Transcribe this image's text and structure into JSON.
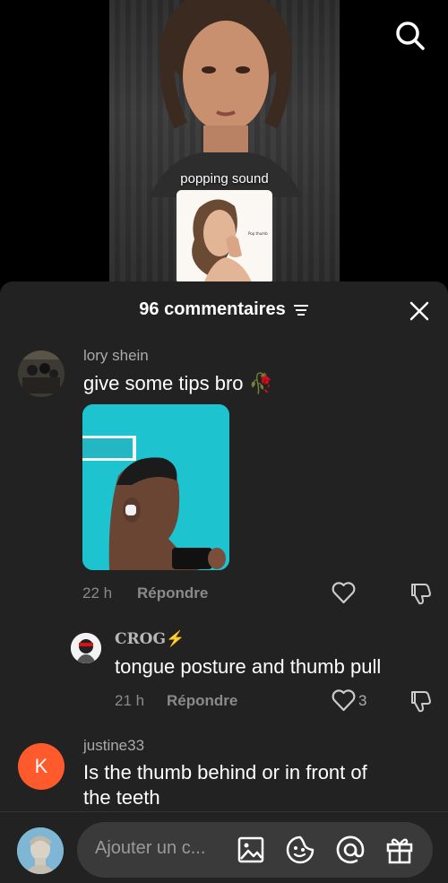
{
  "video": {
    "caption": "popping sound",
    "search_icon": "search-icon"
  },
  "comments_header": {
    "count_label": "96 commentaires",
    "filter_icon": "sort-filter-icon",
    "close_icon": "close-icon"
  },
  "comments": [
    {
      "username": "lory shein",
      "text": "give some tips bro",
      "emoji": "🥀",
      "time": "22 h",
      "reply_label": "Répondre",
      "like_count": ""
    },
    {
      "username": "CROG",
      "username_badge": "⚡",
      "text": "tongue posture and thumb pull",
      "time": "21 h",
      "reply_label": "Répondre",
      "like_count": "3"
    },
    {
      "username": "justine33",
      "avatar_letter": "K",
      "text_line1": "Is the thumb behind or in front of",
      "text_line2": "the teeth"
    }
  ],
  "composer": {
    "placeholder": "Ajouter un c...",
    "icons": [
      "image-icon",
      "sticker-icon",
      "mention-icon",
      "gift-icon"
    ]
  },
  "colors": {
    "sheet_bg": "#222222",
    "avatar_k": "#fe5a2c",
    "photo_bg": "#1ec3d0"
  }
}
